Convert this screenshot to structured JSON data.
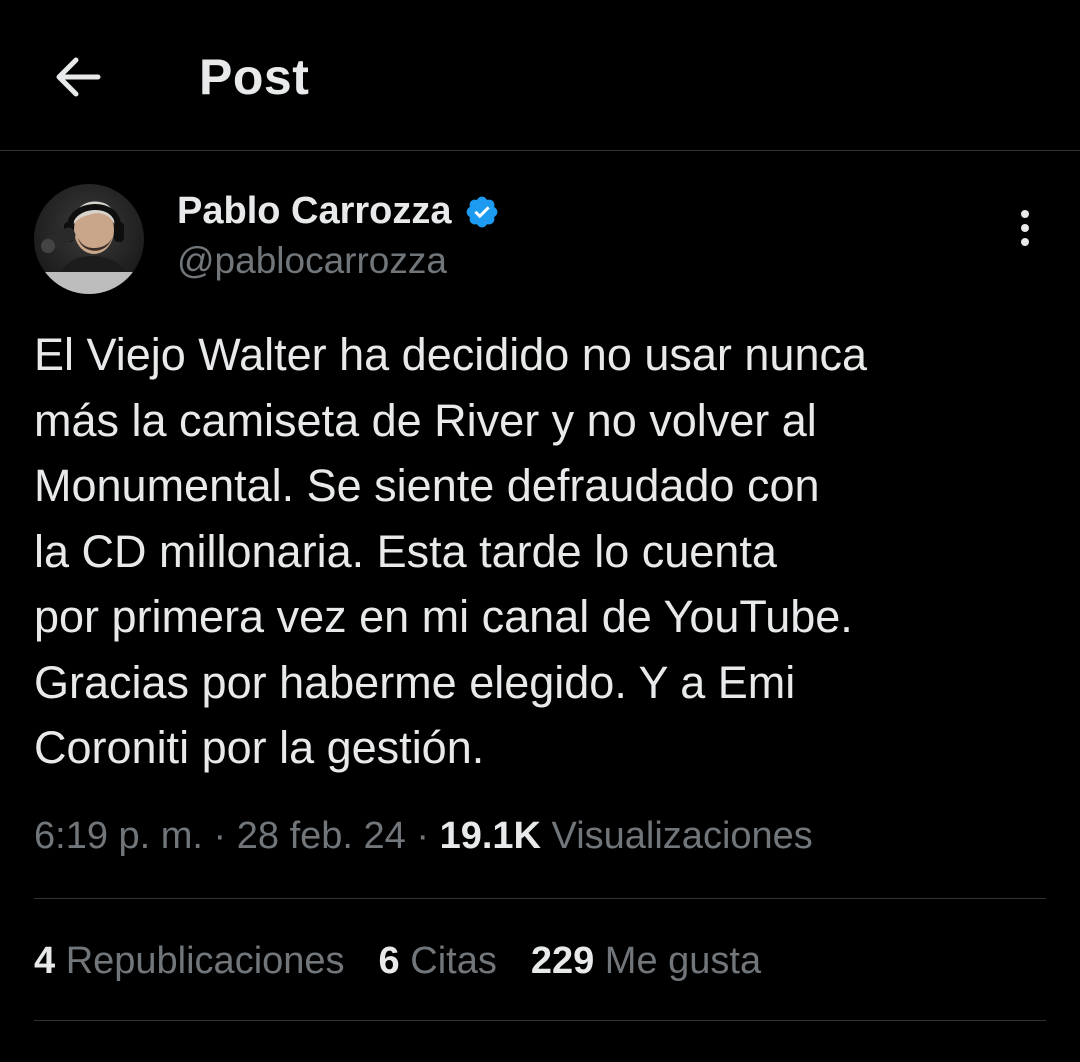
{
  "header": {
    "title": "Post",
    "back_icon": "arrow-left-icon"
  },
  "author": {
    "name": "Pablo Carrozza",
    "handle": "@pablocarrozza",
    "verified": true,
    "verified_color": "#1d9bf0"
  },
  "more_icon": "more-vertical-icon",
  "tweet": {
    "lines": [
      "El Viejo Walter ha decidido no usar nunca",
      "más la camiseta de River y no volver al",
      "Monumental. Se siente defraudado con",
      "la CD millonaria. Esta tarde lo cuenta",
      "por primera vez en mi canal de YouTube.",
      "Gracias por haberme elegido. Y a Emi",
      "Coroniti por la gestión."
    ]
  },
  "meta": {
    "time": "6:19 p. m.",
    "sep1": " · ",
    "date": "28 feb. 24",
    "sep2": " · ",
    "views_count": "19.1K",
    "views_label": " Visualizaciones"
  },
  "stats": {
    "reposts_count": "4",
    "reposts_label": " Republicaciones",
    "quotes_count": "6",
    "quotes_label": " Citas",
    "likes_count": "229",
    "likes_label": " Me gusta"
  },
  "colors": {
    "background": "#000000",
    "primary_text": "#e7e9ea",
    "secondary_text": "#71767b",
    "divider": "#2f3336",
    "accent": "#1d9bf0"
  }
}
